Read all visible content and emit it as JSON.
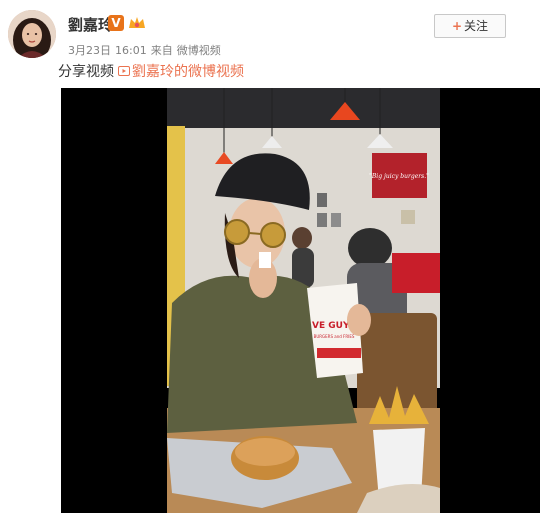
{
  "user": {
    "name": "劉嘉玲",
    "verified_badge": "V"
  },
  "follow_button": {
    "icon": "+",
    "label": "关注"
  },
  "meta": {
    "date": "3月23日",
    "time": "16:01",
    "from": "来自",
    "source": "微博视频"
  },
  "post": {
    "text": "分享视频",
    "video_link_label": "劉嘉玲的微博视频"
  },
  "video": {
    "restaurant_sign": "\"Big juicy burgers.\"",
    "cup_brand": "VE GUYS",
    "cup_tagline": "BURGERS and FRIES"
  },
  "colors": {
    "accent": "#eb7350",
    "badge": "#e8731a",
    "meta_gray": "#808080"
  }
}
